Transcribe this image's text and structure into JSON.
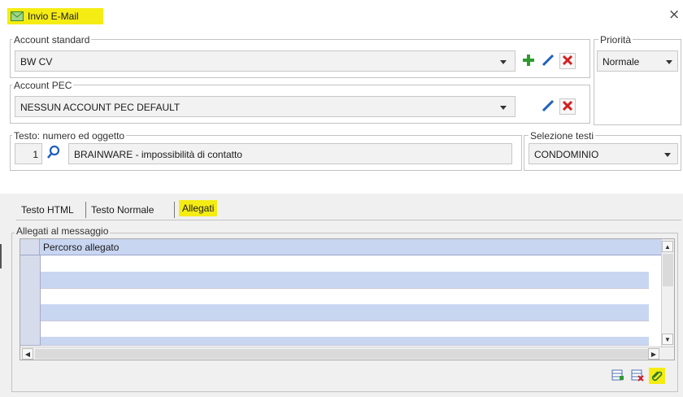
{
  "window": {
    "title": "Invio E-Mail",
    "close_glyph": "×",
    "icon": "mail-window-icon"
  },
  "account_standard": {
    "legend": "Account standard",
    "value": "BW CV",
    "add_icon": "plus-icon",
    "edit_icon": "pencil-icon",
    "delete_icon": "delete-x-icon"
  },
  "priorita": {
    "legend": "Priorità",
    "value": "Normale"
  },
  "account_pec": {
    "legend": "Account PEC",
    "value": "NESSUN ACCOUNT PEC DEFAULT"
  },
  "testo": {
    "legend": "Testo: numero ed oggetto",
    "numero": "1",
    "oggetto": "BRAINWARE - impossibilità di contatto"
  },
  "selezione_testi": {
    "legend": "Selezione testi",
    "value": "CONDOMINIO"
  },
  "tabs": [
    {
      "label": "Testo HTML",
      "active": false
    },
    {
      "label": "Testo Normale",
      "active": false
    },
    {
      "label": "Allegati",
      "active": true
    }
  ],
  "allegati": {
    "legend": "Allegati al messaggio",
    "column_header": "Percorso allegato",
    "rows": [
      "",
      "",
      "",
      "",
      "",
      "",
      ""
    ]
  },
  "bottom_tools": [
    "grid-add-icon",
    "grid-delete-icon",
    "attach-clip-icon"
  ],
  "colors": {
    "highlight": "#f5ec14",
    "row_alt": "#c9d6f2",
    "add_green": "#2e9b2e",
    "delete_red": "#d42020",
    "edit_blue": "#1f5fbf"
  }
}
